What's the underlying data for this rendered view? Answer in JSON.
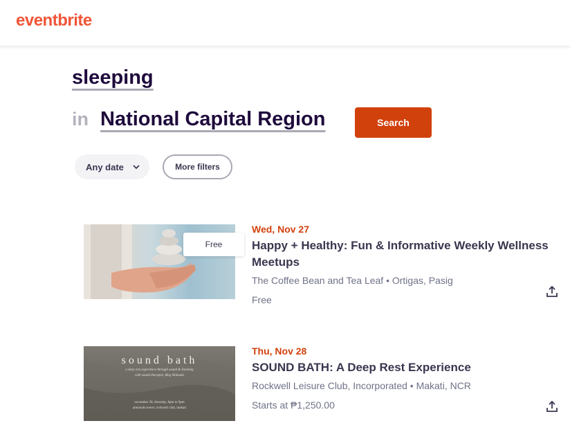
{
  "header": {
    "logo": "eventbrite"
  },
  "search": {
    "query": "sleeping",
    "in_label": "in",
    "location": "National Capital Region",
    "button_label": "Search"
  },
  "filters": {
    "date_label": "Any date",
    "more_label": "More filters"
  },
  "events": [
    {
      "date": "Wed, Nov 27",
      "title": "Happy + Healthy: Fun & Informative Weekly Wellness Meetups",
      "venue": "The Coffee Bean and Tea Leaf • Ortigas, Pasig",
      "price": "Free",
      "badge": "Free"
    },
    {
      "date": "Thu, Nov 28",
      "title": "SOUND BATH: A Deep Rest Experience",
      "venue": "Rockwell Leisure Club, Incorporated • Makati, NCR",
      "price": "Starts at ₱1,250.00",
      "image_text": {
        "heading": "sound bath",
        "line1": "a deep rest experience through sound & listening",
        "line2": "with sound therapist, Meg Shimada",
        "line3": "november 28, thursday, 8pm to 9pm",
        "line4": "amorsolo tower, rockwell club, makati"
      }
    }
  ],
  "colors": {
    "brand": "#f05537",
    "accent": "#d1410c",
    "text": "#39364f",
    "muted": "#6f7287"
  },
  "icons": {
    "chevron": "chevron-down-icon",
    "share": "share-icon"
  }
}
